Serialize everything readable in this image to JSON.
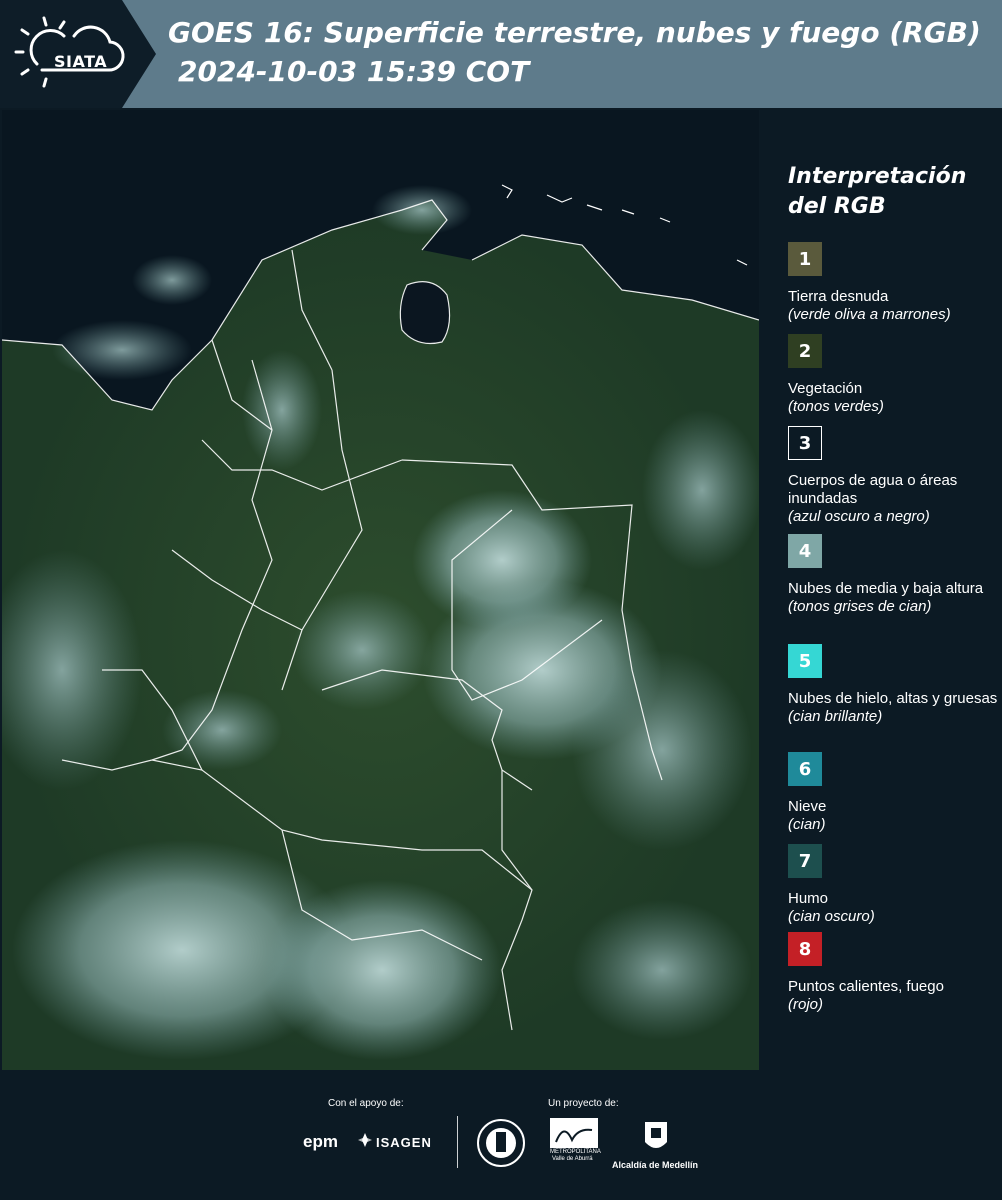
{
  "header": {
    "logo_text": "SIATA",
    "title": "GOES 16: Superficie terrestre, nubes y fuego (RGB)",
    "datetime": "2024-10-03 15:39 COT"
  },
  "legend": {
    "title": "Interpretación del RGB",
    "items": [
      {
        "number": "1",
        "label": "Tierra desnuda",
        "note": "(verde oliva a marrones)",
        "color": "#5a5a3c"
      },
      {
        "number": "2",
        "label": "Vegetación",
        "note": "(tonos verdes)",
        "color": "#2f3f22"
      },
      {
        "number": "3",
        "label": "Cuerpos de agua o áreas inundadas",
        "note": "(azul oscuro a negro)",
        "color": "#0c1a24"
      },
      {
        "number": "4",
        "label": "Nubes de media y baja altura",
        "note": "(tonos grises de cian)",
        "color": "#7fa7a6"
      },
      {
        "number": "5",
        "label": "Nubes de hielo, altas y gruesas",
        "note": "(cian brillante)",
        "color": "#35d7d4"
      },
      {
        "number": "6",
        "label": "Nieve",
        "note": "(cian)",
        "color": "#1f8a9a"
      },
      {
        "number": "7",
        "label": "Humo",
        "note": "(cian oscuro)",
        "color": "#1d4f4e"
      },
      {
        "number": "8",
        "label": "Puntos calientes, fuego",
        "note": "(rojo)",
        "color": "#c42026"
      }
    ]
  },
  "footer": {
    "support_label": "Con el apoyo de:",
    "project_label": "Un proyecto de:",
    "epm": "epm",
    "isagen": "ISAGEN",
    "area_line1": "METROPOLITANA",
    "area_line2": "Valle de Aburrá",
    "alcaldia": "Alcaldía de Medellín"
  }
}
